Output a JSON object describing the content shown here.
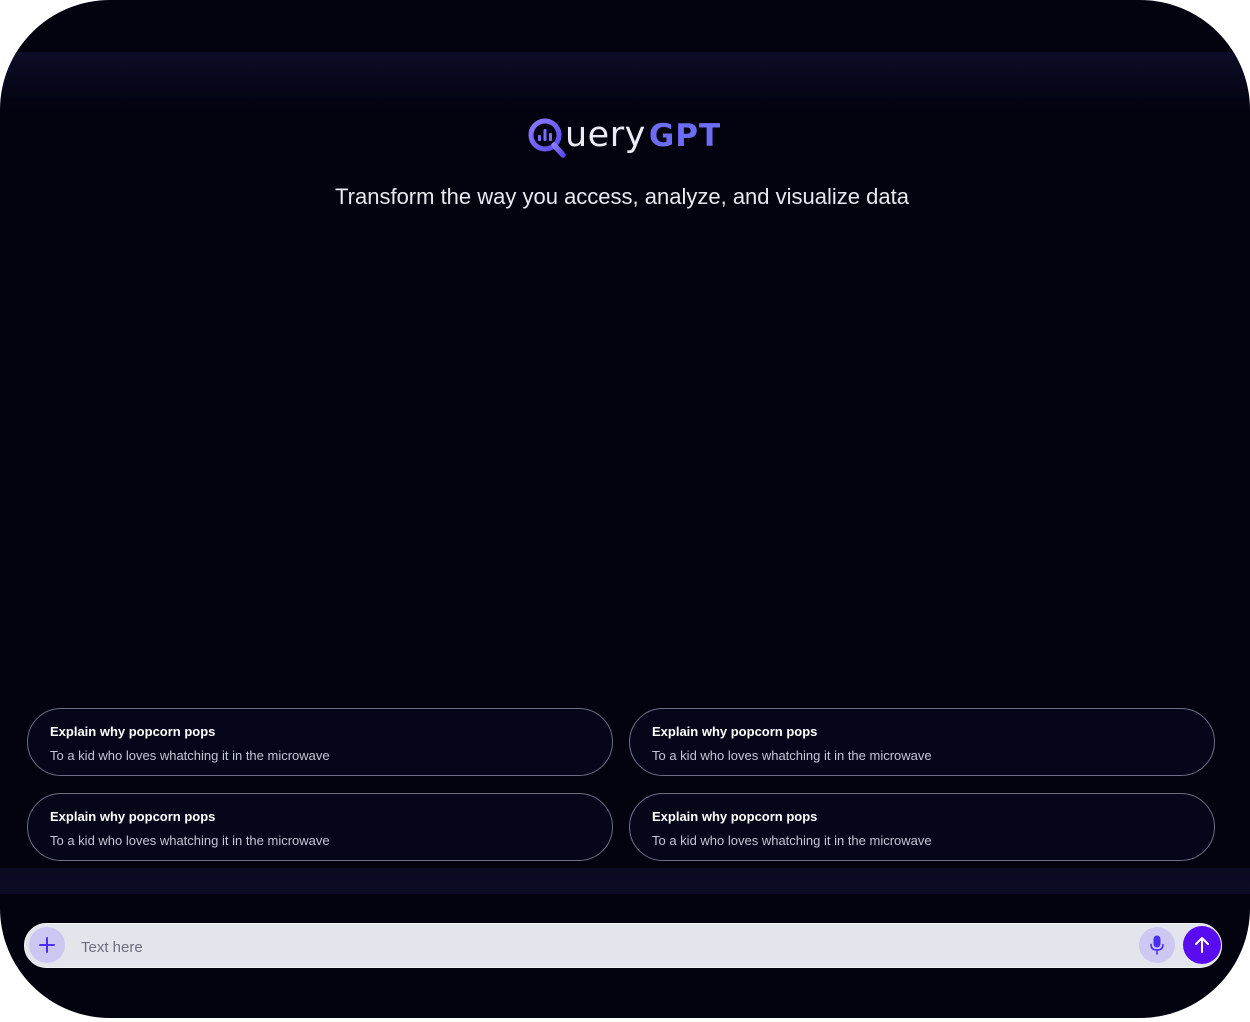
{
  "brand": {
    "name_part1": "uery",
    "name_part2": "GPT",
    "accent_color": "#6d6cf5"
  },
  "tagline": "Transform the way you access, analyze, and visualize data",
  "suggestions": [
    {
      "title": "Explain why popcorn pops",
      "subtitle": "To a kid who loves whatching it in the microwave"
    },
    {
      "title": "Explain why popcorn pops",
      "subtitle": "To a kid who loves whatching it in the microwave"
    },
    {
      "title": "Explain why popcorn pops",
      "subtitle": "To a kid who loves whatching it in the microwave"
    },
    {
      "title": "Explain why popcorn pops",
      "subtitle": "To a kid who loves whatching it in the microwave"
    }
  ],
  "composer": {
    "placeholder": "Text here",
    "value": "",
    "plus_icon": "plus-icon",
    "mic_icon": "microphone-icon",
    "send_icon": "arrow-up-icon",
    "send_color": "#5a0cf0"
  }
}
